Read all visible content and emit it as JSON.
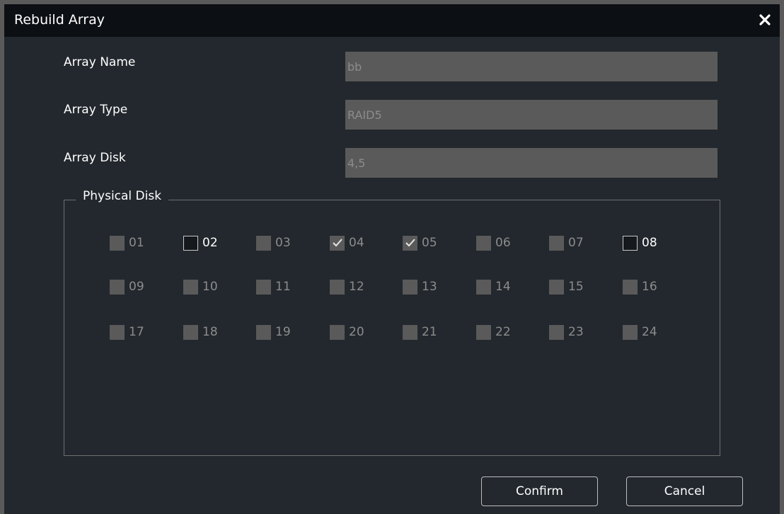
{
  "dialog": {
    "title": "Rebuild Array",
    "close_icon": "close-icon"
  },
  "fields": {
    "array_name": {
      "label": "Array Name",
      "value": "bb"
    },
    "array_type": {
      "label": "Array Type",
      "value": "RAID5"
    },
    "array_disk": {
      "label": "Array Disk",
      "value": "4,5"
    }
  },
  "physical_disk": {
    "legend": "Physical Disk",
    "disks": [
      {
        "label": "01",
        "state": "disabled",
        "checked": false
      },
      {
        "label": "02",
        "state": "available",
        "checked": false
      },
      {
        "label": "03",
        "state": "disabled",
        "checked": false
      },
      {
        "label": "04",
        "state": "disabled",
        "checked": true
      },
      {
        "label": "05",
        "state": "disabled",
        "checked": true
      },
      {
        "label": "06",
        "state": "disabled",
        "checked": false
      },
      {
        "label": "07",
        "state": "disabled",
        "checked": false
      },
      {
        "label": "08",
        "state": "available",
        "checked": false
      },
      {
        "label": "09",
        "state": "disabled",
        "checked": false
      },
      {
        "label": "10",
        "state": "disabled",
        "checked": false
      },
      {
        "label": "11",
        "state": "disabled",
        "checked": false
      },
      {
        "label": "12",
        "state": "disabled",
        "checked": false
      },
      {
        "label": "13",
        "state": "disabled",
        "checked": false
      },
      {
        "label": "14",
        "state": "disabled",
        "checked": false
      },
      {
        "label": "15",
        "state": "disabled",
        "checked": false
      },
      {
        "label": "16",
        "state": "disabled",
        "checked": false
      },
      {
        "label": "17",
        "state": "disabled",
        "checked": false
      },
      {
        "label": "18",
        "state": "disabled",
        "checked": false
      },
      {
        "label": "19",
        "state": "disabled",
        "checked": false
      },
      {
        "label": "20",
        "state": "disabled",
        "checked": false
      },
      {
        "label": "21",
        "state": "disabled",
        "checked": false
      },
      {
        "label": "22",
        "state": "disabled",
        "checked": false
      },
      {
        "label": "23",
        "state": "disabled",
        "checked": false
      },
      {
        "label": "24",
        "state": "disabled",
        "checked": false
      }
    ]
  },
  "buttons": {
    "confirm": "Confirm",
    "cancel": "Cancel"
  },
  "colors": {
    "title_bar": "#0c0f13",
    "panel": "#23282e",
    "disabled_box": "#5a5a5a",
    "text": "#ffffff",
    "muted_text": "#8c8c8c"
  }
}
